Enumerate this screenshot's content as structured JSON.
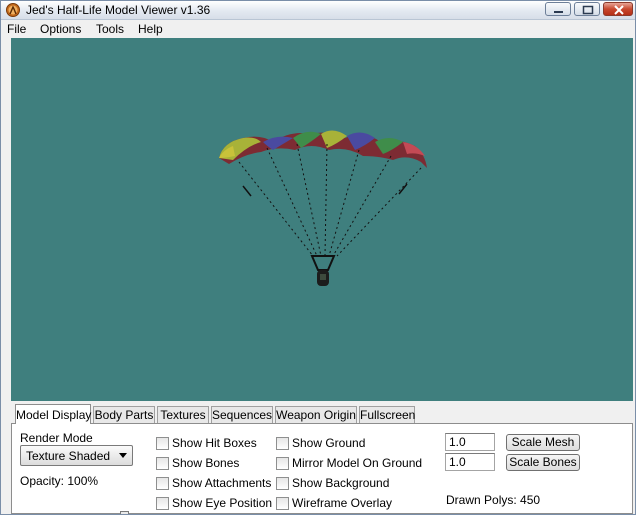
{
  "window": {
    "title": "Jed's Half-Life Model Viewer v1.36"
  },
  "menu": [
    "File",
    "Options",
    "Tools",
    "Help"
  ],
  "tabs": [
    "Model Display",
    "Body Parts",
    "Textures",
    "Sequences",
    "Weapon Origin",
    "Fullscreen"
  ],
  "active_tab": "Model Display",
  "model_display": {
    "render_mode_label": "Render Mode",
    "render_mode_value": "Texture Shaded",
    "opacity_label": "Opacity: 100%",
    "opacity_value": 1.0,
    "checkboxes_col1": [
      "Show Hit Boxes",
      "Show Bones",
      "Show Attachments",
      "Show Eye Position"
    ],
    "checkboxes_col2": [
      "Show Ground",
      "Mirror Model On Ground",
      "Show Background",
      "Wireframe Overlay"
    ],
    "scale_mesh_value": "1.0",
    "scale_mesh_label": "Scale Mesh",
    "scale_bones_value": "1.0",
    "scale_bones_label": "Scale Bones",
    "drawn_polys": "Drawn Polys: 450"
  },
  "colors": {
    "viewport_bg": "#3f7f7e"
  },
  "icons": {
    "app": "half-life-lambda-icon",
    "minimize": "minimize-icon",
    "maximize": "maximize-icon",
    "close": "close-icon"
  }
}
